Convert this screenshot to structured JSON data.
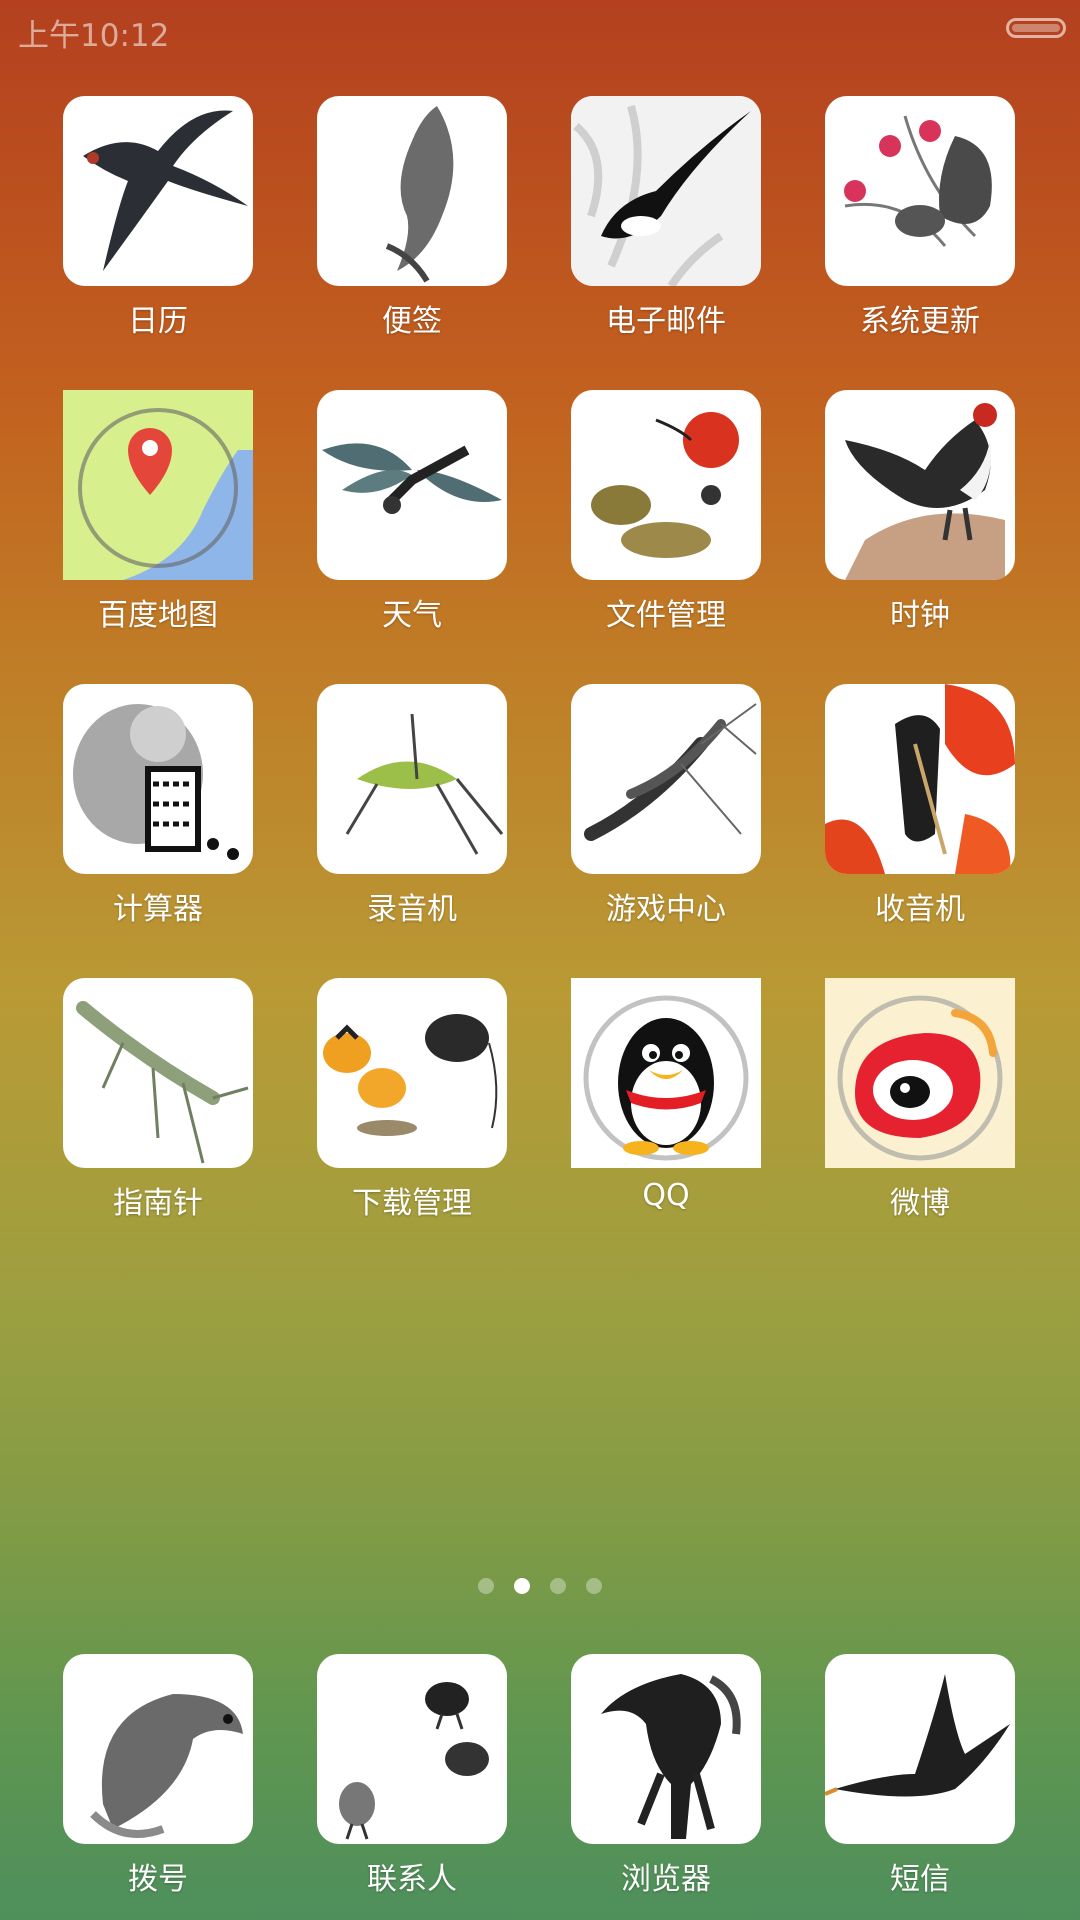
{
  "status_bar": {
    "time": "上午10:12"
  },
  "apps": [
    {
      "label": "日历",
      "icon": "swallow-painting-icon"
    },
    {
      "label": "便签",
      "icon": "carp-painting-icon"
    },
    {
      "label": "电子邮件",
      "icon": "magpie-painting-icon"
    },
    {
      "label": "系统更新",
      "icon": "squirrel-flowers-painting-icon"
    },
    {
      "label": "百度地图",
      "icon": "map-pin-icon"
    },
    {
      "label": "天气",
      "icon": "dragonfly-painting-icon"
    },
    {
      "label": "文件管理",
      "icon": "fruit-painting-icon"
    },
    {
      "label": "时钟",
      "icon": "rooster-painting-icon"
    },
    {
      "label": "计算器",
      "icon": "abacus-painting-icon"
    },
    {
      "label": "录音机",
      "icon": "cricket-painting-icon"
    },
    {
      "label": "游戏中心",
      "icon": "shrimp-painting-icon"
    },
    {
      "label": "收音机",
      "icon": "cicada-painting-icon"
    },
    {
      "label": "指南针",
      "icon": "mantis-painting-icon"
    },
    {
      "label": "下载管理",
      "icon": "persimmon-mouse-painting-icon"
    },
    {
      "label": "QQ",
      "icon": "qq-penguin-icon"
    },
    {
      "label": "微博",
      "icon": "weibo-icon"
    }
  ],
  "page_indicator": {
    "count": 4,
    "active": 1
  },
  "dock": [
    {
      "label": "拨号",
      "icon": "fish-painting-icon"
    },
    {
      "label": "联系人",
      "icon": "chicks-painting-icon"
    },
    {
      "label": "浏览器",
      "icon": "horse-painting-icon"
    },
    {
      "label": "短信",
      "icon": "goose-painting-icon"
    }
  ],
  "colors": {
    "label": "#ffffff",
    "icon_bg": "#ffffff",
    "ink": "#222222"
  }
}
